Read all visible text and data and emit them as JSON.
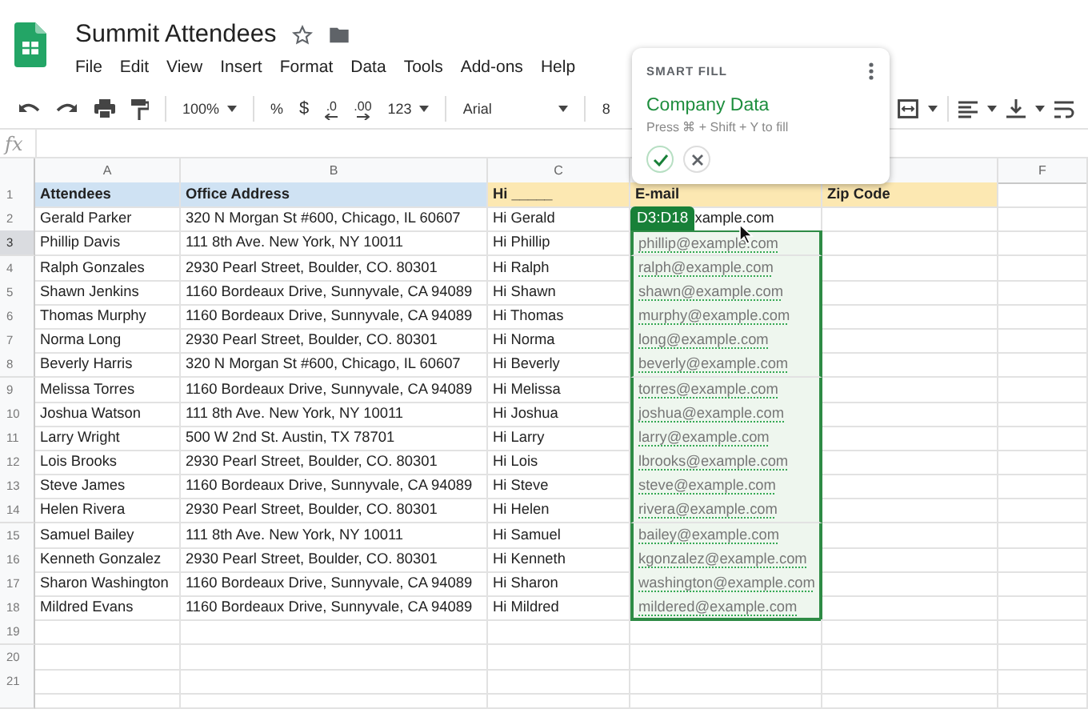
{
  "document": {
    "title": "Summit Attendees"
  },
  "menu": [
    "File",
    "Edit",
    "View",
    "Insert",
    "Format",
    "Data",
    "Tools",
    "Add-ons",
    "Help"
  ],
  "toolbar": {
    "zoom": "100%",
    "percent": "%",
    "currency": "$",
    "decrease_decimals": ".0",
    "increase_decimals": ".00",
    "number_format": "123",
    "font": "Arial",
    "font_size": "8"
  },
  "formula_bar": {
    "label": "fx"
  },
  "columns": {
    "a": "A",
    "b": "B",
    "c": "C",
    "f": "F"
  },
  "rows": [
    {
      "number": "1",
      "kind": "header",
      "selected": false,
      "attendee": "Attendees",
      "office_address": "Office Address",
      "greeting": "Hi _____",
      "email": "E-mail",
      "zip_code": "Zip Code"
    },
    {
      "number": "2",
      "kind": "data",
      "selected": false,
      "attendee": "Gerald Parker",
      "office_address": "320 N Morgan St #600, Chicago, IL 60607",
      "greeting": "Hi Gerald",
      "range_badge": "D3:D18",
      "email": "xample.com"
    },
    {
      "number": "3",
      "kind": "data",
      "selected": true,
      "attendee": "Phillip Davis",
      "office_address": "111 8th Ave. New York, NY 10011",
      "greeting": "Hi Phillip",
      "suggested_email": "phillip@example.com"
    },
    {
      "number": "4",
      "kind": "data",
      "selected": false,
      "attendee": "Ralph Gonzales",
      "office_address": "2930 Pearl Street, Boulder, CO. 80301",
      "greeting": "Hi Ralph",
      "suggested_email": "ralph@example.com"
    },
    {
      "number": "5",
      "kind": "data",
      "selected": false,
      "attendee": "Shawn Jenkins",
      "office_address": "1160 Bordeaux Drive, Sunnyvale, CA 94089",
      "greeting": "Hi Shawn",
      "suggested_email": "shawn@example.com"
    },
    {
      "number": "6",
      "kind": "data",
      "selected": false,
      "attendee": "Thomas Murphy",
      "office_address": "1160 Bordeaux Drive, Sunnyvale, CA 94089",
      "greeting": "Hi Thomas",
      "suggested_email": "murphy@example.com"
    },
    {
      "number": "7",
      "kind": "data",
      "selected": false,
      "attendee": "Norma Long",
      "office_address": "2930 Pearl Street, Boulder, CO. 80301",
      "greeting": "Hi Norma",
      "suggested_email": "long@example.com"
    },
    {
      "number": "8",
      "kind": "data",
      "selected": false,
      "attendee": "Beverly Harris",
      "office_address": "320 N Morgan St #600, Chicago, IL 60607",
      "greeting": "Hi Beverly",
      "suggested_email": "beverly@example.com"
    },
    {
      "number": "9",
      "kind": "data",
      "selected": false,
      "attendee": "Melissa Torres",
      "office_address": "1160 Bordeaux Drive, Sunnyvale, CA 94089",
      "greeting": "Hi Melissa",
      "suggested_email": "torres@example.com"
    },
    {
      "number": "10",
      "kind": "data",
      "selected": false,
      "attendee": "Joshua Watson",
      "office_address": "111 8th Ave. New York, NY 10011",
      "greeting": "Hi Joshua",
      "suggested_email": "joshua@example.com"
    },
    {
      "number": "11",
      "kind": "data",
      "selected": false,
      "attendee": "Larry Wright",
      "office_address": "500 W 2nd St. Austin, TX 78701",
      "greeting": "Hi Larry",
      "suggested_email": "larry@example.com"
    },
    {
      "number": "12",
      "kind": "data",
      "selected": false,
      "attendee": "Lois Brooks",
      "office_address": "2930 Pearl Street, Boulder, CO. 80301",
      "greeting": "Hi Lois",
      "suggested_email": "lbrooks@example.com"
    },
    {
      "number": "13",
      "kind": "data",
      "selected": false,
      "attendee": "Steve James",
      "office_address": "1160 Bordeaux Drive, Sunnyvale, CA 94089",
      "greeting": "Hi Steve",
      "suggested_email": "steve@example.com"
    },
    {
      "number": "14",
      "kind": "data",
      "selected": false,
      "attendee": "Helen Rivera",
      "office_address": "2930 Pearl Street, Boulder, CO. 80301",
      "greeting": "Hi Helen",
      "suggested_email": "rivera@example.com"
    },
    {
      "number": "15",
      "kind": "data",
      "selected": false,
      "attendee": "Samuel Bailey",
      "office_address": "111 8th Ave. New York, NY 10011",
      "greeting": "Hi Samuel",
      "suggested_email": "bailey@example.com"
    },
    {
      "number": "16",
      "kind": "data",
      "selected": false,
      "attendee": "Kenneth Gonzalez",
      "office_address": "2930 Pearl Street, Boulder, CO. 80301",
      "greeting": "Hi Kenneth",
      "suggested_email": "kgonzalez@example.com"
    },
    {
      "number": "17",
      "kind": "data",
      "selected": false,
      "attendee": "Sharon Washington",
      "office_address": "1160 Bordeaux Drive, Sunnyvale, CA 94089",
      "greeting": "Hi Sharon",
      "suggested_email": "washington@example.com"
    },
    {
      "number": "18",
      "kind": "data",
      "selected": false,
      "attendee": "Mildred Evans",
      "office_address": "1160 Bordeaux Drive, Sunnyvale, CA 94089",
      "greeting": "Hi Mildred",
      "suggested_email": "mildered@example.com"
    },
    {
      "number": "19",
      "kind": "data",
      "selected": false
    },
    {
      "number": "20",
      "kind": "data",
      "selected": false
    },
    {
      "number": "21",
      "kind": "data",
      "selected": false
    }
  ],
  "smart_fill": {
    "heading": "SMART FILL",
    "suggestion": "Company Data",
    "hint": "Press ⌘ + Shift + Y to fill"
  }
}
